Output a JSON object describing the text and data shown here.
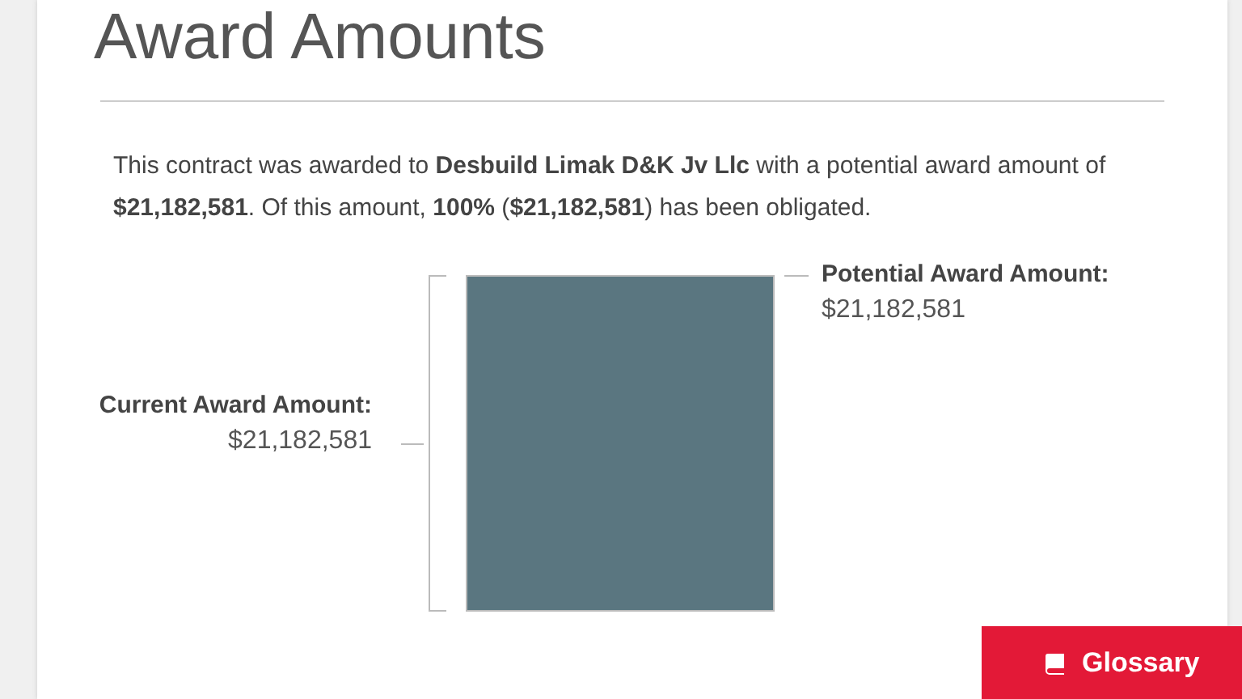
{
  "title": "Award Amounts",
  "summary": "This contract was awarded to **Desbuild Limak D&K Jv Llc** with a potential award amount of **$21,182,581**.  Of this amount, **100%** (**$21,182,581**) has been obligated.",
  "potential": {
    "label": "Potential Award Amount:",
    "value": "$21,182,581"
  },
  "current": {
    "label": "Current Award Amount:",
    "value": "$21,182,581"
  },
  "glossary_button": {
    "label": "Glossary"
  }
}
